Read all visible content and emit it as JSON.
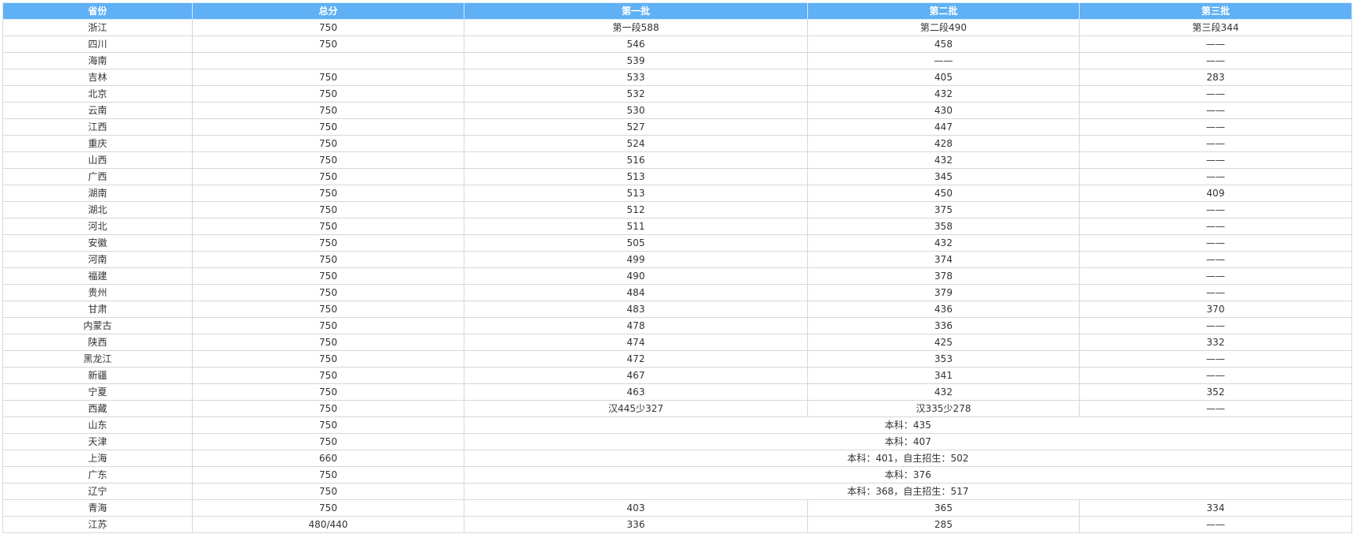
{
  "table": {
    "headers": [
      "省份",
      "总分",
      "第一批",
      "第二批",
      "第三批"
    ],
    "rows": [
      {
        "province": "浙江",
        "total": "750",
        "batch1": "第一段588",
        "batch2": "第二段490",
        "batch3": "第三段344"
      },
      {
        "province": "四川",
        "total": "750",
        "batch1": "546",
        "batch2": "458",
        "batch3": "——"
      },
      {
        "province": "海南",
        "total": "",
        "batch1": "539",
        "batch2": "——",
        "batch3": "——"
      },
      {
        "province": "吉林",
        "total": "750",
        "batch1": "533",
        "batch2": "405",
        "batch3": "283"
      },
      {
        "province": "北京",
        "total": "750",
        "batch1": "532",
        "batch2": "432",
        "batch3": "——"
      },
      {
        "province": "云南",
        "total": "750",
        "batch1": "530",
        "batch2": "430",
        "batch3": "——"
      },
      {
        "province": "江西",
        "total": "750",
        "batch1": "527",
        "batch2": "447",
        "batch3": "——"
      },
      {
        "province": "重庆",
        "total": "750",
        "batch1": "524",
        "batch2": "428",
        "batch3": "——"
      },
      {
        "province": "山西",
        "total": "750",
        "batch1": "516",
        "batch2": "432",
        "batch3": "——"
      },
      {
        "province": "广西",
        "total": "750",
        "batch1": "513",
        "batch2": "345",
        "batch3": "——"
      },
      {
        "province": "湖南",
        "total": "750",
        "batch1": "513",
        "batch2": "450",
        "batch3": "409"
      },
      {
        "province": "湖北",
        "total": "750",
        "batch1": "512",
        "batch2": "375",
        "batch3": "——"
      },
      {
        "province": "河北",
        "total": "750",
        "batch1": "511",
        "batch2": "358",
        "batch3": "——"
      },
      {
        "province": "安徽",
        "total": "750",
        "batch1": "505",
        "batch2": "432",
        "batch3": "——"
      },
      {
        "province": "河南",
        "total": "750",
        "batch1": "499",
        "batch2": "374",
        "batch3": "——"
      },
      {
        "province": "福建",
        "total": "750",
        "batch1": "490",
        "batch2": "378",
        "batch3": "——"
      },
      {
        "province": "贵州",
        "total": "750",
        "batch1": "484",
        "batch2": "379",
        "batch3": "——"
      },
      {
        "province": "甘肃",
        "total": "750",
        "batch1": "483",
        "batch2": "436",
        "batch3": "370"
      },
      {
        "province": "内蒙古",
        "total": "750",
        "batch1": "478",
        "batch2": "336",
        "batch3": "——"
      },
      {
        "province": "陕西",
        "total": "750",
        "batch1": "474",
        "batch2": "425",
        "batch3": "332"
      },
      {
        "province": "黑龙江",
        "total": "750",
        "batch1": "472",
        "batch2": "353",
        "batch3": "——"
      },
      {
        "province": "新疆",
        "total": "750",
        "batch1": "467",
        "batch2": "341",
        "batch3": "——"
      },
      {
        "province": "宁夏",
        "total": "750",
        "batch1": "463",
        "batch2": "432",
        "batch3": "352"
      },
      {
        "province": "西藏",
        "total": "750",
        "batch1": "汉445少327",
        "batch2": "汉335少278",
        "batch3": "——"
      },
      {
        "province": "山东",
        "total": "750",
        "merged": "本科：435"
      },
      {
        "province": "天津",
        "total": "750",
        "merged": "本科：407"
      },
      {
        "province": "上海",
        "total": "660",
        "merged": "本科：401，自主招生：502"
      },
      {
        "province": "广东",
        "total": "750",
        "merged": "本科：376"
      },
      {
        "province": "辽宁",
        "total": "750",
        "merged": "本科：368，自主招生：517"
      },
      {
        "province": "青海",
        "total": "750",
        "batch1": "403",
        "batch2": "365",
        "batch3": "334"
      },
      {
        "province": "江苏",
        "total": "480/440",
        "batch1": "336",
        "batch2": "285",
        "batch3": "——"
      }
    ]
  },
  "colors": {
    "header_bg": "#5fb0f5",
    "header_text": "#ffffff",
    "border": "#d7d7d7",
    "body_text": "#333333"
  }
}
